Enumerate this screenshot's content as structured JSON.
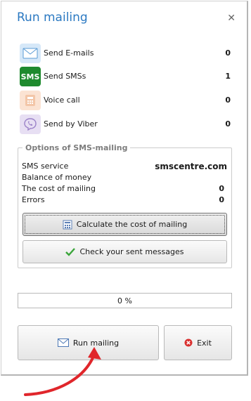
{
  "window": {
    "title": "Run mailing"
  },
  "channels": [
    {
      "icon": "email-icon",
      "label": "Send E-mails",
      "count": "0"
    },
    {
      "icon": "sms-icon",
      "icon_text": "SMS",
      "label": "Send SMSs",
      "count": "1"
    },
    {
      "icon": "phone-icon",
      "label": "Voice call",
      "count": "0"
    },
    {
      "icon": "viber-icon",
      "label": "Send by Viber",
      "count": "0"
    }
  ],
  "options": {
    "title": "Options of SMS-mailing",
    "rows": [
      {
        "label": "SMS service",
        "value": "smscentre.com"
      },
      {
        "label": "Balance of money",
        "value": ""
      },
      {
        "label": "The cost of mailing",
        "value": "0"
      },
      {
        "label": "Errors",
        "value": "0"
      }
    ],
    "calculate_label": "Calculate the cost of mailing",
    "check_label": "Check your sent messages"
  },
  "progress": {
    "value": 0,
    "text": "0 %"
  },
  "footer": {
    "run_label": "Run mailing",
    "exit_label": "Exit"
  },
  "colors": {
    "accent": "#2b79c2",
    "sms_green": "#1e8a2e",
    "exit_red": "#d9302f",
    "arrow_red": "#e0262b"
  }
}
